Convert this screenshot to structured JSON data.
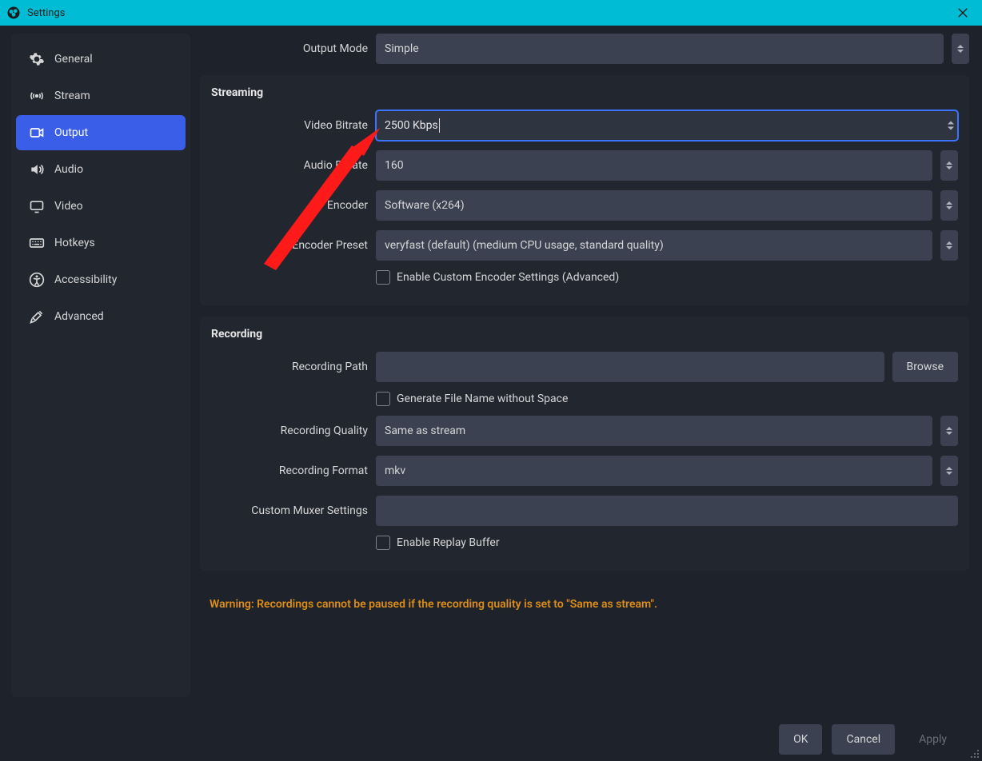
{
  "window": {
    "title": "Settings"
  },
  "sidebar": {
    "items": [
      {
        "label": "General"
      },
      {
        "label": "Stream"
      },
      {
        "label": "Output"
      },
      {
        "label": "Audio"
      },
      {
        "label": "Video"
      },
      {
        "label": "Hotkeys"
      },
      {
        "label": "Accessibility"
      },
      {
        "label": "Advanced"
      }
    ]
  },
  "output_mode": {
    "label": "Output Mode",
    "value": "Simple"
  },
  "streaming": {
    "title": "Streaming",
    "video_bitrate": {
      "label": "Video Bitrate",
      "value": "2500 Kbps"
    },
    "audio_bitrate": {
      "label": "Audio Bitrate",
      "value": "160"
    },
    "encoder": {
      "label": "Encoder",
      "value": "Software (x264)"
    },
    "encoder_preset": {
      "label": "Encoder Preset",
      "value": "veryfast (default) (medium CPU usage, standard quality)"
    },
    "enable_custom": {
      "label": "Enable Custom Encoder Settings (Advanced)"
    }
  },
  "recording": {
    "title": "Recording",
    "path": {
      "label": "Recording Path",
      "value": "",
      "browse": "Browse"
    },
    "gen_filename": {
      "label": "Generate File Name without Space"
    },
    "quality": {
      "label": "Recording Quality",
      "value": "Same as stream"
    },
    "format": {
      "label": "Recording Format",
      "value": "mkv"
    },
    "muxer": {
      "label": "Custom Muxer Settings",
      "value": ""
    },
    "replay": {
      "label": "Enable Replay Buffer"
    }
  },
  "warning": "Warning: Recordings cannot be paused if the recording quality is set to \"Same as stream\".",
  "footer": {
    "ok": "OK",
    "cancel": "Cancel",
    "apply": "Apply"
  }
}
